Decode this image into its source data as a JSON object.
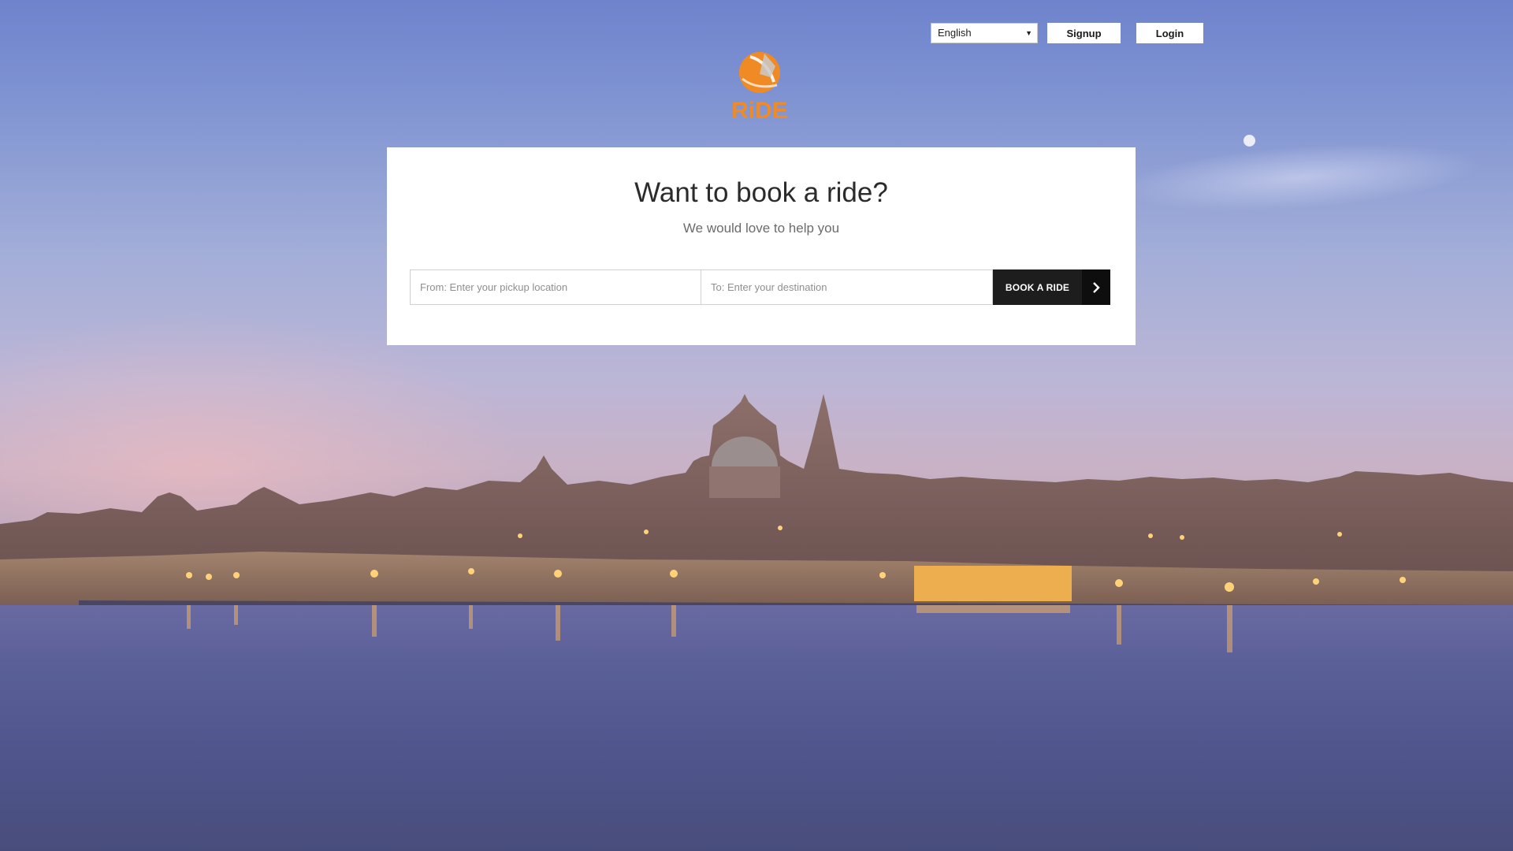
{
  "header": {
    "language": {
      "selected": "English",
      "arrow_icon": "dropdown-arrow-icon"
    },
    "signup_label": "Signup",
    "login_label": "Login"
  },
  "logo": {
    "text": "RiDE",
    "icon": "ride-logo",
    "brand_color": "#f08a24"
  },
  "booking": {
    "title": "Want to book a ride?",
    "subtitle": "We would love to help you",
    "from_placeholder": "From: Enter your pickup location",
    "to_placeholder": "To: Enter your destination",
    "button_label": "BOOK A RIDE",
    "button_icon": "chevron-right-icon"
  },
  "background": {
    "scene": "city-skyline-at-dusk",
    "icon": "background-image"
  }
}
